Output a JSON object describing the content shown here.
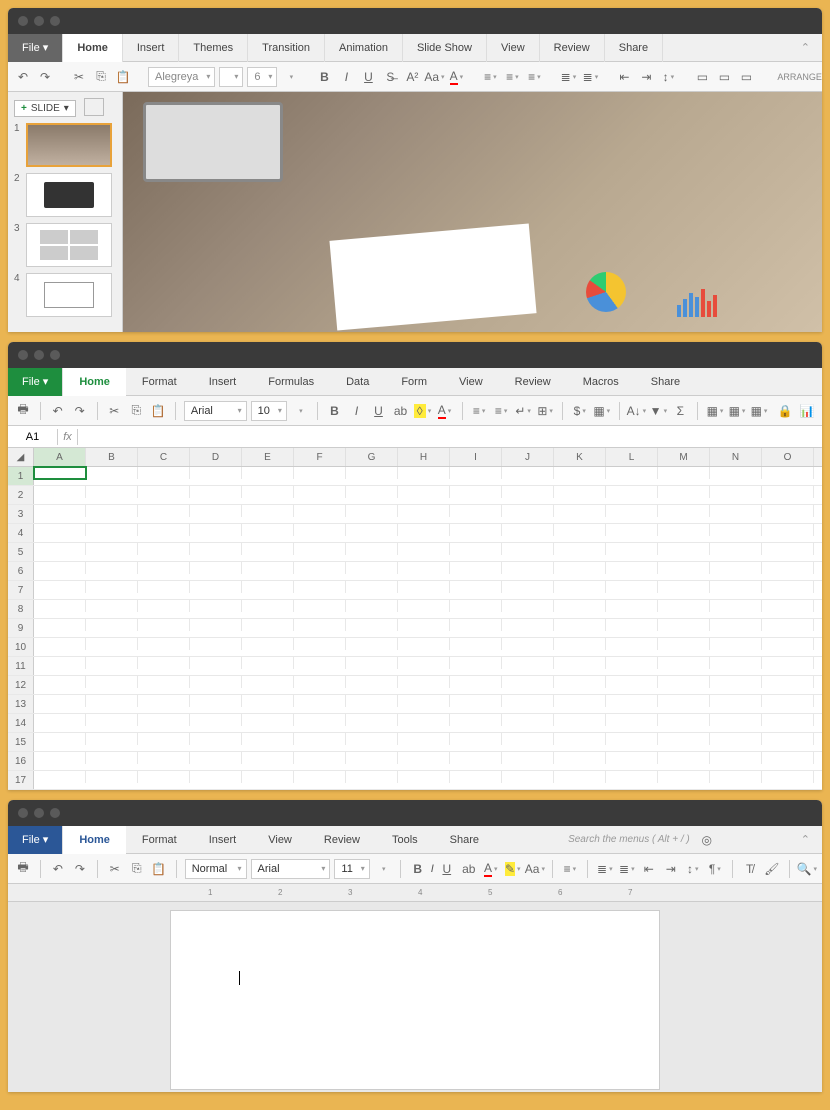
{
  "app1": {
    "menu_file": "File ▾",
    "tabs": [
      "Home",
      "Insert",
      "Themes",
      "Transition",
      "Animation",
      "Slide Show",
      "View",
      "Review",
      "Share"
    ],
    "font": "Alegreya",
    "fontsize": "6",
    "arrange": "ARRANGE",
    "slide_btn": "SLIDE",
    "thumbs": [
      "1",
      "2",
      "3",
      "4"
    ]
  },
  "app2": {
    "menu_file": "File ▾",
    "tabs": [
      "Home",
      "Format",
      "Insert",
      "Formulas",
      "Data",
      "Form",
      "View",
      "Review",
      "Macros",
      "Share"
    ],
    "font": "Arial",
    "fontsize": "10",
    "cellref": "A1",
    "fx": "fx",
    "cols": [
      "A",
      "B",
      "C",
      "D",
      "E",
      "F",
      "G",
      "H",
      "I",
      "J",
      "K",
      "L",
      "M",
      "N",
      "O"
    ],
    "rowcount": 17
  },
  "app3": {
    "menu_file": "File ▾",
    "tabs": [
      "Home",
      "Format",
      "Insert",
      "View",
      "Review",
      "Tools",
      "Share"
    ],
    "search_placeholder": "Search the menus  ( Alt + / )",
    "style": "Normal",
    "font": "Arial",
    "fontsize": "11",
    "ruler_marks": [
      "1",
      "2",
      "3",
      "4",
      "5",
      "6",
      "7"
    ]
  }
}
